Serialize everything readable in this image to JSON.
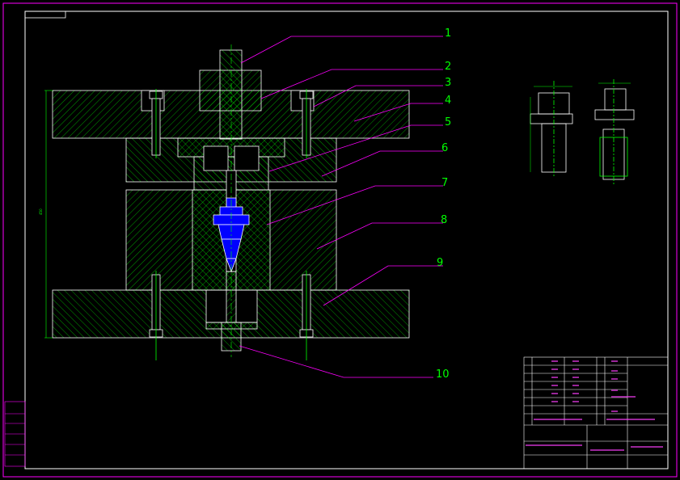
{
  "callouts": [
    "1",
    "2",
    "3",
    "4",
    "5",
    "6",
    "7",
    "8",
    "9",
    "10"
  ],
  "dimension_text": "450",
  "colors": {
    "background": "#000000",
    "frame": "#ffffff",
    "outline": "#ffffff",
    "hatch": "#00ff00",
    "leader": "#ff00ff",
    "centerline": "#00ff00",
    "workpiece": "#0000ff",
    "callout_text": "#00ff00"
  }
}
